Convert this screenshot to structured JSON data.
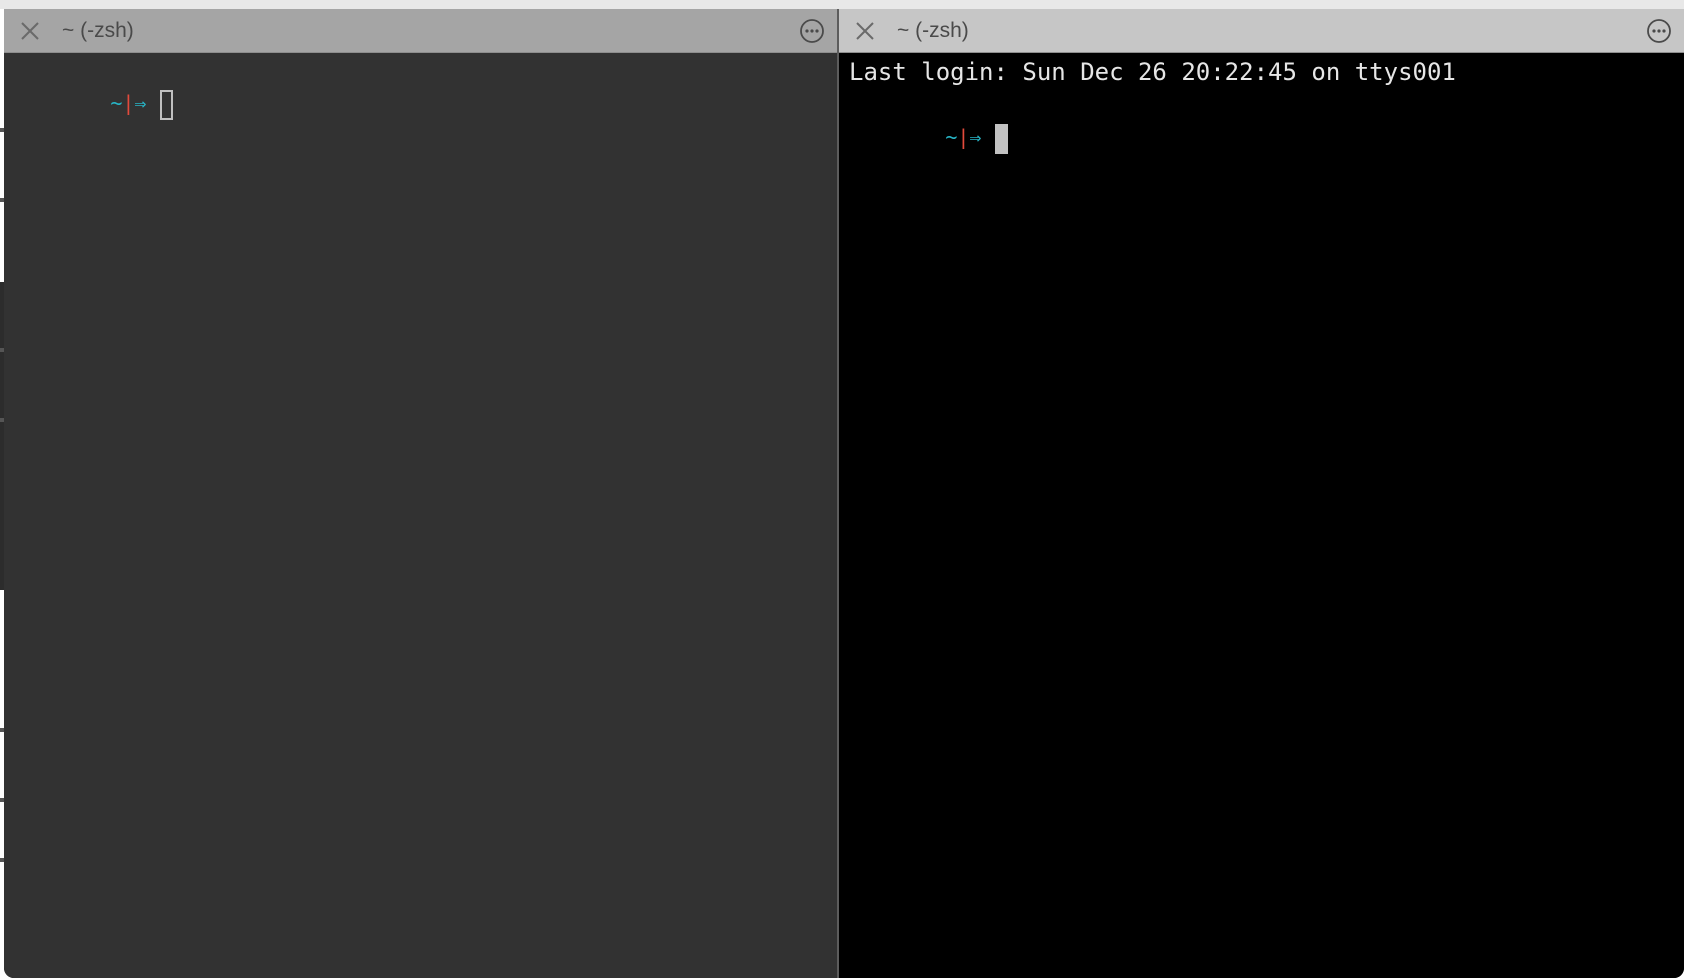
{
  "window": {
    "title": "~ (-zsh)"
  },
  "panes": [
    {
      "title": "~ (-zsh)",
      "active": false,
      "prompt": {
        "tilde": "~",
        "separator": "|",
        "arrow": "⇒"
      },
      "cursor_style": "hollow"
    },
    {
      "title": "~ (-zsh)",
      "active": true,
      "last_login": "Last login: Sun Dec 26 20:22:45 on ttys001",
      "prompt": {
        "tilde": "~",
        "separator": "|",
        "arrow": "⇒"
      },
      "cursor_style": "block"
    }
  ],
  "icons": {
    "close": "close-icon",
    "more": "more-options-icon"
  },
  "colors": {
    "left_pane_bg": "#323232",
    "right_pane_bg": "#000000",
    "left_tab_bg": "#a5a5a5",
    "right_tab_bg": "#c6c6c6",
    "prompt_cyan": "#27b6c7",
    "prompt_red": "#e24a3c",
    "text": "#e6e6e6"
  }
}
